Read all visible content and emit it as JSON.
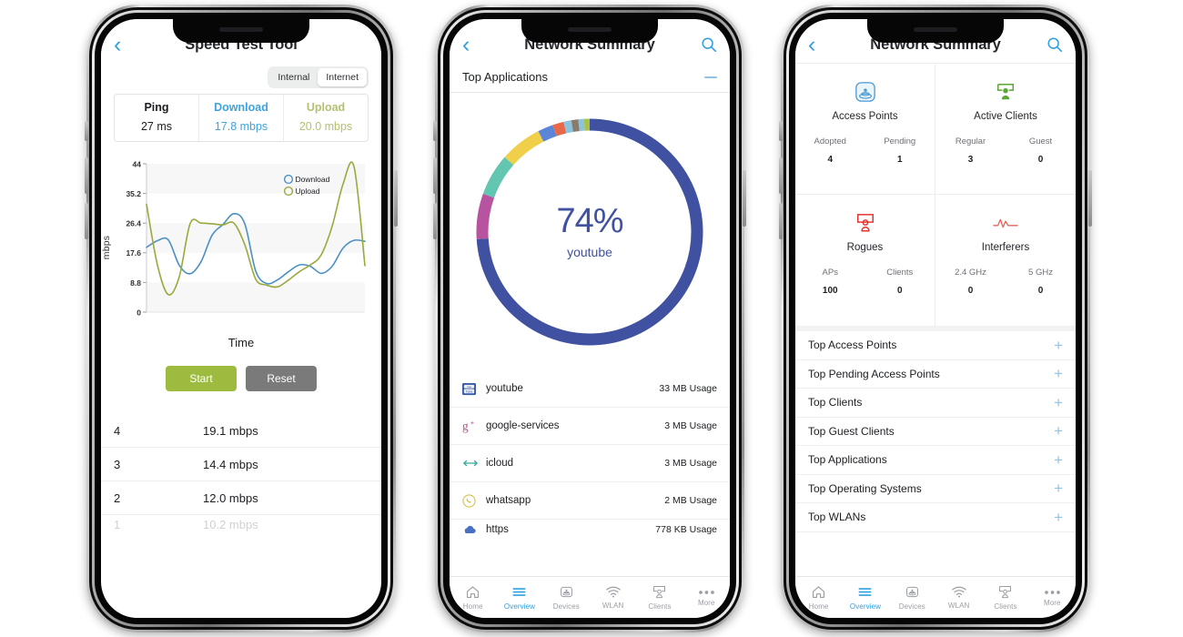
{
  "phone1": {
    "nav": {
      "back_icon": "chevron-left-icon",
      "title": "Speed Test Tool"
    },
    "segmented": {
      "options": [
        "Internal",
        "Internet"
      ],
      "selected": "Internet"
    },
    "stats": [
      {
        "label": "Ping",
        "value": "27 ms",
        "color": "#1b1d21"
      },
      {
        "label": "Download",
        "value": "17.8 mbps",
        "color": "#3fa3dd"
      },
      {
        "label": "Upload",
        "value": "20.0 mbps",
        "color": "#b6bf6f"
      }
    ],
    "chart_axis_label_y": "mbps",
    "chart_axis_label_x": "Time",
    "buttons": {
      "start": "Start",
      "reset": "Reset"
    },
    "results": [
      {
        "index": "4",
        "value": "19.1 mbps"
      },
      {
        "index": "3",
        "value": "14.4 mbps"
      },
      {
        "index": "2",
        "value": "12.0 mbps"
      },
      {
        "index": "1",
        "value": "10.2 mbps"
      }
    ]
  },
  "phone2": {
    "nav": {
      "back_icon": "chevron-left-icon",
      "title": "Network Summary",
      "search_icon": "search-icon"
    },
    "section": {
      "title": "Top Applications",
      "collapse_icon": "minus-icon"
    },
    "donut_center": {
      "percent": "74%",
      "label": "youtube"
    },
    "apps": [
      {
        "icon": "youtube-icon",
        "name": "youtube",
        "usage": "33 MB Usage"
      },
      {
        "icon": "google-plus-icon",
        "name": "google-services",
        "usage": "3 MB Usage"
      },
      {
        "icon": "icloud-icon",
        "name": "icloud",
        "usage": "3 MB Usage"
      },
      {
        "icon": "whatsapp-icon",
        "name": "whatsapp",
        "usage": "2 MB Usage"
      },
      {
        "icon": "https-icon",
        "name": "https",
        "usage": "778 KB Usage"
      }
    ],
    "tabs": [
      {
        "label": "Home",
        "icon": "home-icon",
        "active": false
      },
      {
        "label": "Overview",
        "icon": "overview-icon",
        "active": true
      },
      {
        "label": "Devices",
        "icon": "devices-icon",
        "active": false
      },
      {
        "label": "WLAN",
        "icon": "wlan-icon",
        "active": false
      },
      {
        "label": "Clients",
        "icon": "clients-icon",
        "active": false
      },
      {
        "label": "More",
        "icon": "more-icon",
        "active": false
      }
    ]
  },
  "phone3": {
    "nav": {
      "back_icon": "chevron-left-icon",
      "title": "Network Summary",
      "search_icon": "search-icon"
    },
    "cards": [
      {
        "icon": "access-point-icon",
        "icon_color": "#4a9ad4",
        "title": "Access Points",
        "metrics": [
          {
            "label": "Adopted",
            "value": "4"
          },
          {
            "label": "Pending",
            "value": "1"
          }
        ]
      },
      {
        "icon": "active-client-icon",
        "icon_color": "#5aa736",
        "title": "Active Clients",
        "metrics": [
          {
            "label": "Regular",
            "value": "3"
          },
          {
            "label": "Guest",
            "value": "0"
          }
        ]
      },
      {
        "icon": "rogue-icon",
        "icon_color": "#e5322d",
        "title": "Rogues",
        "metrics": [
          {
            "label": "APs",
            "value": "100"
          },
          {
            "label": "Clients",
            "value": "0"
          }
        ]
      },
      {
        "icon": "interferer-icon",
        "icon_color": "#e5645a",
        "title": "Interferers",
        "metrics": [
          {
            "label": "2.4 GHz",
            "value": "0"
          },
          {
            "label": "5 GHz",
            "value": "0"
          }
        ]
      }
    ],
    "top_lists": [
      {
        "label": "Top Access Points",
        "action_icon": "plus-icon"
      },
      {
        "label": "Top Pending Access Points",
        "action_icon": "plus-icon"
      },
      {
        "label": "Top Clients",
        "action_icon": "plus-icon"
      },
      {
        "label": "Top Guest Clients",
        "action_icon": "plus-icon"
      },
      {
        "label": "Top Applications",
        "action_icon": "plus-icon"
      },
      {
        "label": "Top Operating Systems",
        "action_icon": "plus-icon"
      },
      {
        "label": "Top WLANs",
        "action_icon": "plus-icon"
      }
    ],
    "tabs": [
      {
        "label": "Home",
        "icon": "home-icon",
        "active": false
      },
      {
        "label": "Overview",
        "icon": "overview-icon",
        "active": true
      },
      {
        "label": "Devices",
        "icon": "devices-icon",
        "active": false
      },
      {
        "label": "WLAN",
        "icon": "wlan-icon",
        "active": false
      },
      {
        "label": "Clients",
        "icon": "clients-icon",
        "active": false
      },
      {
        "label": "More",
        "icon": "more-icon",
        "active": false
      }
    ]
  },
  "chart_data": [
    {
      "type": "line",
      "title": "",
      "xlabel": "Time",
      "ylabel": "mbps",
      "ylim": [
        0,
        44
      ],
      "yticks": [
        0,
        8.8,
        17.6,
        26.4,
        35.2,
        44
      ],
      "ytick_labels": [
        "0",
        "8.8",
        "17.6",
        "26.4",
        "35.2",
        "44"
      ],
      "grid": true,
      "legend_position": "top-right",
      "x": [
        0,
        1,
        2,
        3,
        4,
        5,
        6,
        7,
        8,
        9,
        10,
        11,
        12,
        13,
        14,
        15,
        16,
        17,
        18,
        19,
        20
      ],
      "series": [
        {
          "name": "Download",
          "color": "#4a90c4",
          "values": [
            19.2,
            21.2,
            21.4,
            13.9,
            11.4,
            15.0,
            22.8,
            26.0,
            29.2,
            26.2,
            12.2,
            8.5,
            9.6,
            12.0,
            14.0,
            13.6,
            11.5,
            13.6,
            19.0,
            21.3,
            21.0
          ]
        },
        {
          "name": "Upload",
          "color": "#9aa93c",
          "values": [
            32.0,
            14.0,
            5.2,
            10.5,
            26.3,
            26.4,
            26.2,
            25.9,
            26.4,
            20.0,
            9.8,
            8.0,
            7.5,
            9.5,
            12.0,
            14.0,
            17.0,
            25.5,
            38.0,
            43.2,
            13.8
          ]
        }
      ]
    },
    {
      "type": "pie",
      "title": "Top Applications",
      "center_label": "74%",
      "center_sublabel": "youtube",
      "labels": [
        "youtube",
        "seg-2",
        "seg-3",
        "seg-4",
        "seg-5",
        "seg-6",
        "seg-7",
        "seg-8",
        "seg-9",
        "seg-10"
      ],
      "values": [
        74,
        6.5,
        6.0,
        6.0,
        2.2,
        1.6,
        1.1,
        1.0,
        0.8,
        0.8
      ],
      "colors": [
        "#3f51a0",
        "#b7539f",
        "#63c6b0",
        "#f0d04b",
        "#5b86d8",
        "#e8694a",
        "#8cc4e0",
        "#8a7b6a",
        "#8cc4e0",
        "#a8c24a"
      ],
      "legend_position": "none"
    }
  ]
}
